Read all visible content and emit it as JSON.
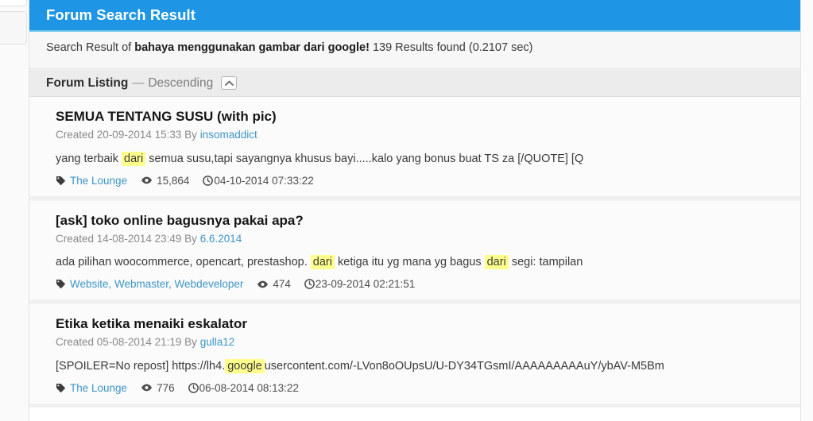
{
  "header": {
    "title": "Forum Search Result",
    "accent_color": "#1e96e5"
  },
  "summary": {
    "prefix": "Search Result of ",
    "query": "bahaya menggunakan gambar dari google!",
    "suffix": " 139 Results found (0.2107 sec)",
    "result_count": "139",
    "elapsed": "0.2107 sec"
  },
  "listing": {
    "title": "Forum Listing",
    "separator": "—",
    "order": "Descending",
    "collapse_icon": "chevron-up-icon"
  },
  "highlight_color": "#ffff8c",
  "results": [
    {
      "title": "SEMUA TENTANG SUSU (with pic)",
      "created_label": "Created",
      "created_date": "20-09-2014 15:33",
      "by_label": "By",
      "author": "insomaddict",
      "snippet_parts": [
        {
          "text": "yang terbaik ",
          "highlight": false
        },
        {
          "text": "dari",
          "highlight": true
        },
        {
          "text": " semua susu,tapi sayangnya khusus bayi.....kalo yang bonus buat TS za [/QUOTE] [Q",
          "highlight": false
        }
      ],
      "tags": "The Lounge",
      "views": "15,864",
      "date": "04-10-2014 07:33:22"
    },
    {
      "title": "[ask] toko online bagusnya pakai apa?",
      "created_label": "Created",
      "created_date": "14-08-2014 23:49",
      "by_label": "By",
      "author": "6.6.2014",
      "snippet_parts": [
        {
          "text": "ada pilihan woocommerce, opencart, prestashop. ",
          "highlight": false
        },
        {
          "text": "dari",
          "highlight": true
        },
        {
          "text": " ketiga itu yg mana yg bagus ",
          "highlight": false
        },
        {
          "text": "dari",
          "highlight": true
        },
        {
          "text": " segi: tampilan",
          "highlight": false
        }
      ],
      "tags": "Website, Webmaster, Webdeveloper",
      "views": "474",
      "date": "23-09-2014 02:21:51"
    },
    {
      "title": "Etika ketika menaiki eskalator",
      "created_label": "Created",
      "created_date": "05-08-2014 21:19",
      "by_label": "By",
      "author": "gulla12",
      "snippet_parts": [
        {
          "text": "[SPOILER=No repost] https://lh4.",
          "highlight": false
        },
        {
          "text": "google",
          "highlight": true
        },
        {
          "text": "usercontent.com/-LVon8oOUpsU/U-DY34TGsmI/AAAAAAAAAuY/ybAV-M5Bm",
          "highlight": false
        }
      ],
      "tags": "The Lounge",
      "views": "776",
      "date": "06-08-2014 08:13:22"
    }
  ],
  "icons": {
    "tag": "tag-icon",
    "views": "eye-icon",
    "date": "clock-icon"
  }
}
